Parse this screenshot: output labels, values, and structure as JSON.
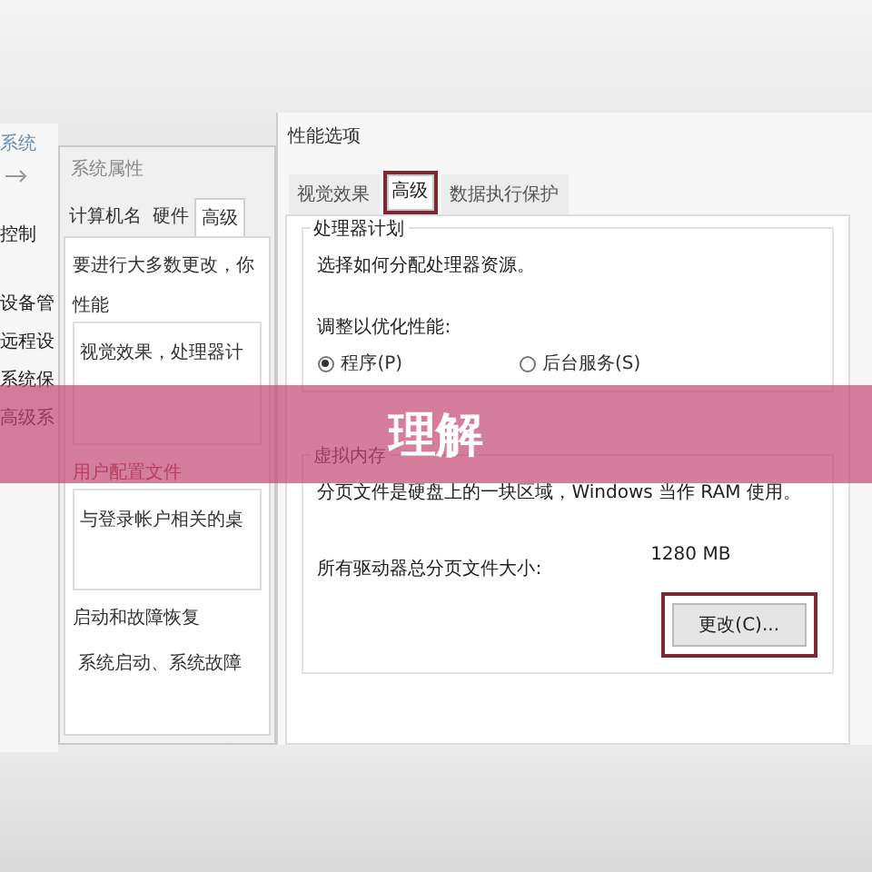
{
  "back_window": {
    "title": "系统",
    "sidebar": [
      "控制",
      "设备管",
      "远程设",
      "系统保",
      "高级系"
    ]
  },
  "system_properties": {
    "title": "系统属性",
    "tabs": [
      {
        "label": "计算机名",
        "selected": false
      },
      {
        "label": "硬件",
        "selected": false
      },
      {
        "label": "高级",
        "selected": true
      }
    ],
    "intro": "要进行大多数更改，你",
    "groups": [
      {
        "title": "性能",
        "text": "视觉效果，处理器计"
      },
      {
        "title": "用户配置文件",
        "text": "与登录帐户相关的桌"
      },
      {
        "title": "启动和故障恢复",
        "text": "系统启动、系统故障"
      }
    ]
  },
  "performance_options": {
    "title": "性能选项",
    "tabs": [
      {
        "label": "视觉效果",
        "selected": false,
        "highlighted": false
      },
      {
        "label": "高级",
        "selected": true,
        "highlighted": true
      },
      {
        "label": "数据执行保护",
        "selected": false,
        "highlighted": false
      }
    ],
    "processor": {
      "title": "处理器计划",
      "description": "选择如何分配处理器资源。",
      "prompt": "调整以优化性能:",
      "options": [
        {
          "label": "程序(P)",
          "selected": true
        },
        {
          "label": "后台服务(S)",
          "selected": false
        }
      ]
    },
    "virtual_memory": {
      "title": "虚拟内存",
      "description": "分页文件是硬盘上的一块区域，Windows 当作 RAM 使用。",
      "total_label": "所有驱动器总分页文件大小:",
      "total_value": "1280 MB",
      "button": {
        "label": "更改(C)...",
        "highlighted": true
      }
    }
  },
  "banner": {
    "text": "理解"
  }
}
